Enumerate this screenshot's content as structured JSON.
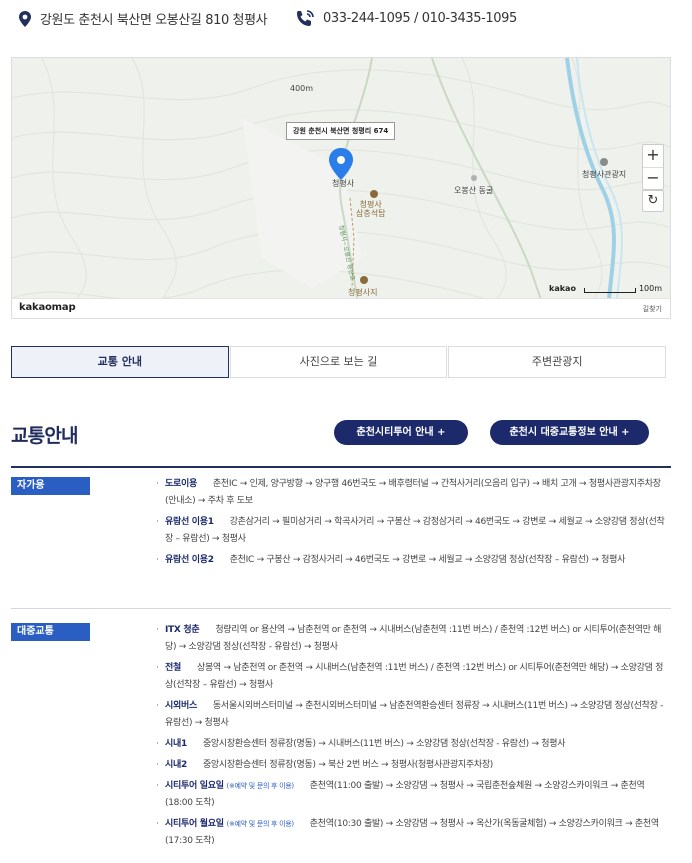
{
  "header": {
    "address_icon": "map-pin-icon",
    "address": "강원도 춘천시 북산면 오봉산길 810 청평사",
    "phone_icon": "phone-icon",
    "phone": "033-244-1095 / 010-3435-1095"
  },
  "map": {
    "callout": "강원 춘천시 북산면 청평리 674",
    "labels": {
      "pin": "청평사",
      "elev": "400m",
      "temple_stone": "청평사\n삼층석탑",
      "temple_site": "청평사지",
      "obong": "오봉산 동굴",
      "rest": "청평사관광지",
      "trail": "청평사~오봉산 등산로"
    },
    "zoom_in": "+",
    "zoom_out": "−",
    "refresh_icon": "refresh-icon",
    "scale_brand": "kakao",
    "scale": "100m",
    "logo_a": "kakao",
    "logo_b": "map",
    "report": "길찾기"
  },
  "tabs": [
    {
      "label": "교통 안내",
      "active": true
    },
    {
      "label": "사진으로 보는 길",
      "active": false
    },
    {
      "label": "주변관광지",
      "active": false
    }
  ],
  "section": {
    "title": "교통안내",
    "btn_citytour": "춘천시티투어 안내 +",
    "btn_public": "춘천시 대중교통정보 안내 +"
  },
  "blocks": [
    {
      "category": "자가용",
      "items": [
        {
          "name": "도로이용",
          "note": "",
          "text": "춘천IC → 인제, 양구방향 → 양구행 46번국도 → 배후령터널 → 간척사거리(오음리 입구) → 배치 고개 → 청평사관광지주차장(안내소) → 주차 후 도보"
        },
        {
          "name": "유람선 이용1",
          "note": "",
          "text": "강촌삼거리 → 필미삼거리 → 학곡사거리 → 구봉산 → 감정삼거리 → 46번국도 → 강변로 → 세월교 → 소양강댐 정상(선착장 – 유람선) → 청평사"
        },
        {
          "name": "유람선 이용2",
          "note": "",
          "text": "춘천IC → 구봉산 → 감정사거리 → 46번국도 → 강변로 → 세월교 → 소양강댐 정상(선착장 – 유람선) → 청평사"
        }
      ]
    },
    {
      "category": "대중교통",
      "items": [
        {
          "name": "ITX 청춘",
          "note": "",
          "text": "청량리역 or 용산역 → 남춘천역 or 춘천역 → 시내버스(남춘천역 :11번 버스) / 춘천역 :12번 버스) or 시티투어(춘천역만 해당) → 소양강댐 정상(선착장 - 유람선) → 청평사"
        },
        {
          "name": "전철",
          "note": "",
          "text": "상봉역 → 남춘천역 or 춘천역 → 시내버스(남춘천역 :11번 버스) / 춘천역 :12번 버스) or 시티투어(춘천역만 해당) → 소양강댐 정상(선착장 – 유람선) → 청평사"
        },
        {
          "name": "시외버스",
          "note": "",
          "text": "동서울시외버스터미널 → 춘천시외버스터미널 → 남춘천역환승센터 정류장 → 시내버스(11번 버스) → 소양강댐 정상(선착장 - 유람선) → 청평사"
        },
        {
          "name": "시내1",
          "note": "",
          "text": "중앙시장환승센터 정류장(명동) → 시내버스(11번 버스) → 소양강댐 정상(선착장 - 유람선) → 청평사"
        },
        {
          "name": "시내2",
          "note": "",
          "text": "중앙시장환승센터 정류장(명동) → 북산 2번 버스 → 청평사(청평사관광지주차장)"
        },
        {
          "name": "시티투어 일요일",
          "note": "(※예약 및 문의 후 이용)",
          "text": "춘천역(11:00 출발) → 소양강댐 → 청평사 → 국립춘천숲체원 → 소양강스카이워크 → 춘천역(18:00 도착)"
        },
        {
          "name": "시티투어 월요일",
          "note": "(※예약 및 문의 후 이용)",
          "text": "춘천역(10:30 출발) → 소양강댐 → 청평사 → 옥산가(옥동굴체험) → 소양강스카이워크 → 춘천역(17:30 도착)"
        }
      ]
    }
  ]
}
